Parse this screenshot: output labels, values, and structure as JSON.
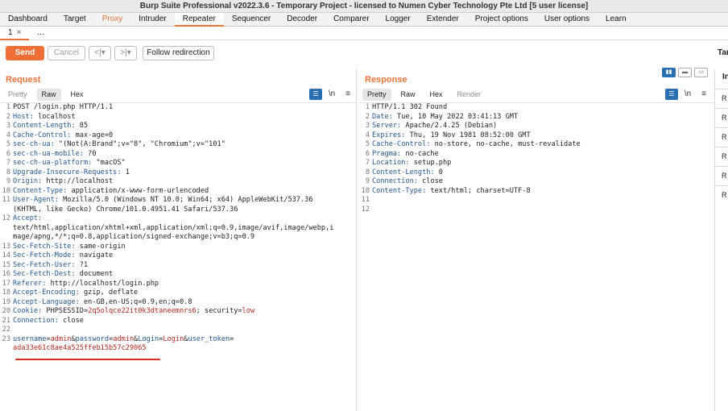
{
  "window": {
    "title": "Burp Suite Professional v2022.3.6 - Temporary Project - licensed to Numen Cyber Technology Pte Ltd [5 user license]"
  },
  "main_tabs": [
    {
      "label": "Dashboard"
    },
    {
      "label": "Target"
    },
    {
      "label": "Proxy"
    },
    {
      "label": "Intruder"
    },
    {
      "label": "Repeater"
    },
    {
      "label": "Sequencer"
    },
    {
      "label": "Decoder"
    },
    {
      "label": "Comparer"
    },
    {
      "label": "Logger"
    },
    {
      "label": "Extender"
    },
    {
      "label": "Project options"
    },
    {
      "label": "User options"
    },
    {
      "label": "Learn"
    }
  ],
  "sub_tabs": {
    "tab1": "1",
    "tab1_close": "×",
    "more": "..."
  },
  "toolbar": {
    "send": "Send",
    "cancel": "Cancel",
    "back": "<",
    "back_drop": "|▾",
    "fwd": ">",
    "fwd_drop": "|▾",
    "follow": "Follow redirection",
    "target_label": "Tar"
  },
  "request": {
    "title": "Request",
    "tabs": [
      "Pretty",
      "Raw",
      "Hex"
    ],
    "tool_wrap": "\\n",
    "tool_menu": "≡",
    "lines": [
      {
        "n": "1",
        "segs": [
          {
            "t": "POST /login.php HTTP/1.1",
            "c": "hv"
          }
        ]
      },
      {
        "n": "2",
        "segs": [
          {
            "t": "Host:",
            "c": "hk"
          },
          {
            "t": " localhost",
            "c": "hv"
          }
        ]
      },
      {
        "n": "3",
        "segs": [
          {
            "t": "Content-Length:",
            "c": "hk"
          },
          {
            "t": " 85",
            "c": "hv"
          }
        ]
      },
      {
        "n": "4",
        "segs": [
          {
            "t": "Cache-Control:",
            "c": "hk"
          },
          {
            "t": " max-age=0",
            "c": "hv"
          }
        ]
      },
      {
        "n": "5",
        "segs": [
          {
            "t": "sec-ch-ua:",
            "c": "hk"
          },
          {
            "t": " \"(Not(A:Brand\";v=\"8\", \"Chromium\";v=\"101\"",
            "c": "hv"
          }
        ]
      },
      {
        "n": "6",
        "segs": [
          {
            "t": "sec-ch-ua-mobile:",
            "c": "hk"
          },
          {
            "t": " ?0",
            "c": "hv"
          }
        ]
      },
      {
        "n": "7",
        "segs": [
          {
            "t": "sec-ch-ua-platform:",
            "c": "hk"
          },
          {
            "t": " \"macOS\"",
            "c": "hv"
          }
        ]
      },
      {
        "n": "8",
        "segs": [
          {
            "t": "Upgrade-Insecure-Requests:",
            "c": "hk"
          },
          {
            "t": " 1",
            "c": "hv"
          }
        ]
      },
      {
        "n": "9",
        "segs": [
          {
            "t": "Origin:",
            "c": "hk"
          },
          {
            "t": " http://localhost",
            "c": "hv"
          }
        ]
      },
      {
        "n": "10",
        "segs": [
          {
            "t": "Content-Type:",
            "c": "hk"
          },
          {
            "t": " application/x-www-form-urlencoded",
            "c": "hv"
          }
        ]
      },
      {
        "n": "11",
        "segs": [
          {
            "t": "User-Agent:",
            "c": "hk"
          },
          {
            "t": " Mozilla/5.0 (Windows NT 10.0; Win64; x64) AppleWebKit/537.36",
            "c": "hv"
          }
        ]
      },
      {
        "n": "",
        "segs": [
          {
            "t": "(KHTML, like Gecko) Chrome/101.0.4951.41 Safari/537.36",
            "c": "hv"
          }
        ]
      },
      {
        "n": "12",
        "segs": [
          {
            "t": "Accept:",
            "c": "hk"
          }
        ]
      },
      {
        "n": "",
        "segs": [
          {
            "t": "text/html,application/xhtml+xml,application/xml;q=0.9,image/avif,image/webp,i",
            "c": "hv"
          }
        ]
      },
      {
        "n": "",
        "segs": [
          {
            "t": "mage/apng,*/*;q=0.8,application/signed-exchange;v=b3;q=0.9",
            "c": "hv"
          }
        ]
      },
      {
        "n": "13",
        "segs": [
          {
            "t": "Sec-Fetch-Site:",
            "c": "hk"
          },
          {
            "t": " same-origin",
            "c": "hv"
          }
        ]
      },
      {
        "n": "14",
        "segs": [
          {
            "t": "Sec-Fetch-Mode:",
            "c": "hk"
          },
          {
            "t": " navigate",
            "c": "hv"
          }
        ]
      },
      {
        "n": "15",
        "segs": [
          {
            "t": "Sec-Fetch-User:",
            "c": "hk"
          },
          {
            "t": " ?1",
            "c": "hv"
          }
        ]
      },
      {
        "n": "16",
        "segs": [
          {
            "t": "Sec-Fetch-Dest:",
            "c": "hk"
          },
          {
            "t": " document",
            "c": "hv"
          }
        ]
      },
      {
        "n": "17",
        "segs": [
          {
            "t": "Referer:",
            "c": "hk"
          },
          {
            "t": " http://localhost/login.php",
            "c": "hv"
          }
        ]
      },
      {
        "n": "18",
        "segs": [
          {
            "t": "Accept-Encoding:",
            "c": "hk"
          },
          {
            "t": " gzip, deflate",
            "c": "hv"
          }
        ]
      },
      {
        "n": "19",
        "segs": [
          {
            "t": "Accept-Language:",
            "c": "hk"
          },
          {
            "t": " en-GB,en-US;q=0.9,en;q=0.8",
            "c": "hv"
          }
        ]
      },
      {
        "n": "20",
        "segs": [
          {
            "t": "Cookie:",
            "c": "hk"
          },
          {
            "t": " PHPSESSID=",
            "c": "hv"
          },
          {
            "t": "2q5olqce22it0k3dtaneemnrs6",
            "c": "pv"
          },
          {
            "t": "; security=",
            "c": "hv"
          },
          {
            "t": "low",
            "c": "pv"
          }
        ]
      },
      {
        "n": "21",
        "segs": [
          {
            "t": "Connection:",
            "c": "hk"
          },
          {
            "t": " close",
            "c": "hv"
          }
        ]
      },
      {
        "n": "22",
        "segs": [
          {
            "t": "",
            "c": "hv"
          }
        ]
      },
      {
        "n": "23",
        "segs": [
          {
            "t": "username",
            "c": "hk"
          },
          {
            "t": "=",
            "c": "hv"
          },
          {
            "t": "admin",
            "c": "pv"
          },
          {
            "t": "&",
            "c": "hv"
          },
          {
            "t": "password",
            "c": "hk"
          },
          {
            "t": "=",
            "c": "hv"
          },
          {
            "t": "admin",
            "c": "pv"
          },
          {
            "t": "&",
            "c": "hv"
          },
          {
            "t": "Login",
            "c": "hk"
          },
          {
            "t": "=",
            "c": "hv"
          },
          {
            "t": "Login",
            "c": "pv"
          },
          {
            "t": "&",
            "c": "hv"
          },
          {
            "t": "user_token",
            "c": "hk"
          },
          {
            "t": "=",
            "c": "hv"
          }
        ]
      },
      {
        "n": "",
        "segs": [
          {
            "t": "ada33e61c8ae4a525ffeb15b57c29065",
            "c": "pv"
          }
        ]
      }
    ]
  },
  "response": {
    "title": "Response",
    "tabs": [
      "Pretty",
      "Raw",
      "Hex",
      "Render"
    ],
    "tool_wrap": "\\n",
    "tool_menu": "≡",
    "lines": [
      {
        "n": "1",
        "segs": [
          {
            "t": "HTTP/1.1 302 Found",
            "c": "hv"
          }
        ]
      },
      {
        "n": "2",
        "segs": [
          {
            "t": "Date:",
            "c": "hk"
          },
          {
            "t": " Tue, 10 May 2022 03:41:13 GMT",
            "c": "hv"
          }
        ]
      },
      {
        "n": "3",
        "segs": [
          {
            "t": "Server:",
            "c": "hk"
          },
          {
            "t": " Apache/2.4.25 (Debian)",
            "c": "hv"
          }
        ]
      },
      {
        "n": "4",
        "segs": [
          {
            "t": "Expires:",
            "c": "hk"
          },
          {
            "t": " Thu, 19 Nov 1981 08:52:00 GMT",
            "c": "hv"
          }
        ]
      },
      {
        "n": "5",
        "segs": [
          {
            "t": "Cache-Control:",
            "c": "hk"
          },
          {
            "t": " no-store, no-cache, must-revalidate",
            "c": "hv"
          }
        ]
      },
      {
        "n": "6",
        "segs": [
          {
            "t": "Pragma:",
            "c": "hk"
          },
          {
            "t": " no-cache",
            "c": "hv"
          }
        ]
      },
      {
        "n": "7",
        "segs": [
          {
            "t": "Location:",
            "c": "hk"
          },
          {
            "t": " setup.php",
            "c": "hv"
          }
        ]
      },
      {
        "n": "8",
        "segs": [
          {
            "t": "Content-Length:",
            "c": "hk"
          },
          {
            "t": " 0",
            "c": "hv"
          }
        ]
      },
      {
        "n": "9",
        "segs": [
          {
            "t": "Connection:",
            "c": "hk"
          },
          {
            "t": " close",
            "c": "hv"
          }
        ]
      },
      {
        "n": "10",
        "segs": [
          {
            "t": "Content-Type:",
            "c": "hk"
          },
          {
            "t": " text/html; charset=UTF-8",
            "c": "hv"
          }
        ]
      },
      {
        "n": "11",
        "segs": [
          {
            "t": "",
            "c": "hv"
          }
        ]
      },
      {
        "n": "12",
        "segs": [
          {
            "t": "",
            "c": "hv"
          }
        ]
      }
    ]
  },
  "inspector": {
    "title": "In",
    "rows": [
      "R",
      "R",
      "R",
      "R",
      "R",
      "R"
    ]
  },
  "colors": {
    "accent": "#e8743b",
    "send": "#ef6f36",
    "header_key": "#23578e",
    "param_value": "#b3261e",
    "annotation": "#d62b1f"
  },
  "icons": {
    "pretty_toggle": "list-icon",
    "layout_split": "split-layout-icon",
    "layout_h": "horizontal-layout-icon",
    "layout_v": "vertical-layout-icon"
  }
}
